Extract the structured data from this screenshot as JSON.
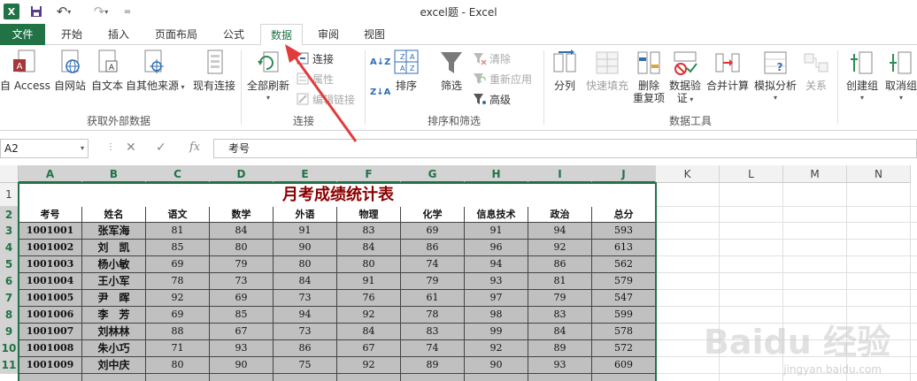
{
  "window": {
    "title": "excel题 - Excel",
    "logo": "X"
  },
  "quick_access": [
    {
      "name": "save-icon",
      "glyph": "💾"
    },
    {
      "name": "undo-icon",
      "glyph": "↶"
    },
    {
      "name": "redo-icon",
      "glyph": "↷"
    },
    {
      "name": "customize-icon",
      "glyph": "≡"
    }
  ],
  "tabs": [
    "文件",
    "开始",
    "插入",
    "页面布局",
    "公式",
    "数据",
    "审阅",
    "视图"
  ],
  "active_tab": "数据",
  "ribbon": {
    "get_external": {
      "label": "获取外部数据",
      "access": "自 Access",
      "web": "自网站",
      "text": "自文本",
      "other": "自其他来源",
      "existing": "现有连接"
    },
    "connections": {
      "label": "连接",
      "refresh_all": "全部刷新",
      "connections": "连接",
      "properties": "属性",
      "edit_links": "编辑链接"
    },
    "sort_filter": {
      "label": "排序和筛选",
      "sort": "排序",
      "filter": "筛选",
      "clear": "清除",
      "reapply": "重新应用",
      "advanced": "高级",
      "sort_az": "A↓Z",
      "sort_za": "Z↓A"
    },
    "data_tools": {
      "label": "数据工具",
      "text_to_columns": "分列",
      "flash_fill": "快速填充",
      "remove_dup_line1": "删除",
      "remove_dup_line2": "重复项",
      "validation_line1": "数据验",
      "validation_line2": "证",
      "consolidate": "合并计算",
      "what_if": "模拟分析",
      "relationships": "关系"
    },
    "outline": {
      "group": "创建组",
      "ungroup": "取消组"
    }
  },
  "formula_bar": {
    "name_box": "A2",
    "cancel": "✕",
    "enter": "✓",
    "fx": "fx",
    "content": "考号"
  },
  "columns": [
    "A",
    "B",
    "C",
    "D",
    "E",
    "F",
    "G",
    "H",
    "I",
    "J",
    "K",
    "L",
    "M",
    "N"
  ],
  "rows": [
    "1",
    "2",
    "3",
    "4",
    "5",
    "6",
    "7",
    "8",
    "9",
    "10",
    "11"
  ],
  "sheet": {
    "title": "月考成绩统计表",
    "headers": [
      "考号",
      "姓名",
      "语文",
      "数学",
      "外语",
      "物理",
      "化学",
      "信息技术",
      "政治",
      "总分"
    ],
    "records": [
      [
        "1001001",
        "张军海",
        "81",
        "84",
        "91",
        "83",
        "69",
        "91",
        "94",
        "593"
      ],
      [
        "1001002",
        "刘　凯",
        "85",
        "80",
        "90",
        "84",
        "86",
        "96",
        "92",
        "613"
      ],
      [
        "1001003",
        "杨小敏",
        "69",
        "79",
        "80",
        "80",
        "74",
        "94",
        "86",
        "562"
      ],
      [
        "1001004",
        "王小军",
        "78",
        "73",
        "84",
        "91",
        "79",
        "93",
        "81",
        "579"
      ],
      [
        "1001005",
        "尹　晖",
        "92",
        "69",
        "73",
        "76",
        "61",
        "97",
        "79",
        "547"
      ],
      [
        "1001006",
        "李　芳",
        "69",
        "85",
        "94",
        "92",
        "78",
        "98",
        "83",
        "599"
      ],
      [
        "1001007",
        "刘林林",
        "88",
        "67",
        "73",
        "84",
        "83",
        "99",
        "84",
        "578"
      ],
      [
        "1001008",
        "朱小巧",
        "71",
        "93",
        "86",
        "67",
        "74",
        "92",
        "89",
        "572"
      ],
      [
        "1001009",
        "刘中庆",
        "80",
        "90",
        "75",
        "92",
        "89",
        "90",
        "93",
        "609"
      ]
    ]
  },
  "watermark": {
    "main": "Baidu 经验",
    "sub": "jingyan.baidu.com"
  },
  "colors": {
    "excel_green": "#217346",
    "title_red": "#8b0000",
    "annotation_arrow": "#e23b3b",
    "cell_gray": "#c0c0c0"
  }
}
